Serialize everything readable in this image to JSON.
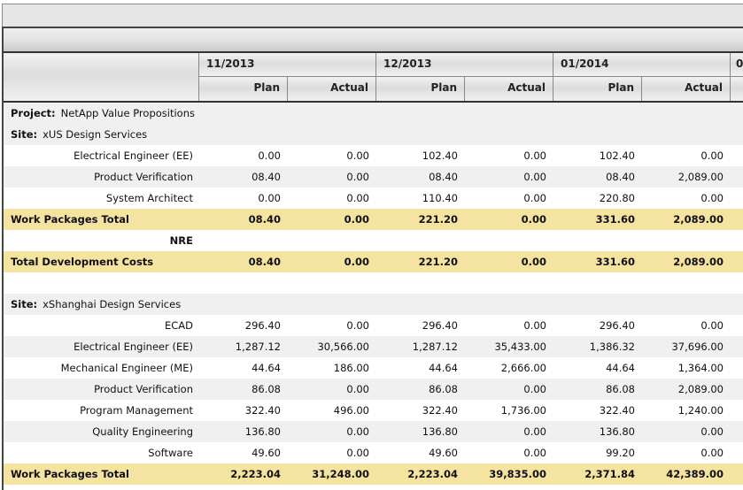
{
  "header": {
    "months": [
      "11/2013",
      "12/2013",
      "01/2014",
      "0"
    ],
    "sub_labels": {
      "plan": "Plan",
      "actual": "Actual"
    }
  },
  "rows": [
    {
      "type": "group",
      "style": "grey",
      "prefix": "Project:",
      "label": "NetApp Value Propositions"
    },
    {
      "type": "group",
      "style": "grey",
      "prefix": "Site:",
      "label": "xUS Design Services"
    },
    {
      "type": "data",
      "style": "white",
      "label": "Electrical Engineer (EE)",
      "values": [
        "0.00",
        "0.00",
        "102.40",
        "0.00",
        "102.40",
        "0.00"
      ]
    },
    {
      "type": "data",
      "style": "grey",
      "label": "Product Verification",
      "values": [
        "08.40",
        "0.00",
        "08.40",
        "0.00",
        "08.40",
        "2,089.00"
      ]
    },
    {
      "type": "data",
      "style": "white",
      "label": "System Architect",
      "values": [
        "0.00",
        "0.00",
        "110.40",
        "0.00",
        "220.80",
        "0.00"
      ]
    },
    {
      "type": "total",
      "style": "yellow",
      "label": "Work Packages Total",
      "values": [
        "08.40",
        "0.00",
        "221.20",
        "0.00",
        "331.60",
        "2,089.00"
      ]
    },
    {
      "type": "heading",
      "style": "white",
      "label": "NRE",
      "values": []
    },
    {
      "type": "total",
      "style": "yellow",
      "label": "Total Development Costs",
      "values": [
        "08.40",
        "0.00",
        "221.20",
        "0.00",
        "331.60",
        "2,089.00"
      ]
    },
    {
      "type": "blank",
      "style": "white",
      "label": "",
      "values": []
    },
    {
      "type": "group",
      "style": "grey",
      "prefix": "Site:",
      "label": "xShanghai Design Services"
    },
    {
      "type": "data",
      "style": "white",
      "label": "ECAD",
      "values": [
        "296.40",
        "0.00",
        "296.40",
        "0.00",
        "296.40",
        "0.00"
      ]
    },
    {
      "type": "data",
      "style": "grey",
      "label": "Electrical Engineer (EE)",
      "values": [
        "1,287.12",
        "30,566.00",
        "1,287.12",
        "35,433.00",
        "1,386.32",
        "37,696.00"
      ]
    },
    {
      "type": "data",
      "style": "white",
      "label": "Mechanical Engineer (ME)",
      "values": [
        "44.64",
        "186.00",
        "44.64",
        "2,666.00",
        "44.64",
        "1,364.00"
      ]
    },
    {
      "type": "data",
      "style": "grey",
      "label": "Product Verification",
      "values": [
        "86.08",
        "0.00",
        "86.08",
        "0.00",
        "86.08",
        "2,089.00"
      ]
    },
    {
      "type": "data",
      "style": "white",
      "label": "Program Management",
      "values": [
        "322.40",
        "496.00",
        "322.40",
        "1,736.00",
        "322.40",
        "1,240.00"
      ]
    },
    {
      "type": "data",
      "style": "grey",
      "label": "Quality Engineering",
      "values": [
        "136.80",
        "0.00",
        "136.80",
        "0.00",
        "136.80",
        "0.00"
      ]
    },
    {
      "type": "data",
      "style": "white",
      "label": "Software",
      "values": [
        "49.60",
        "0.00",
        "49.60",
        "0.00",
        "99.20",
        "0.00"
      ]
    },
    {
      "type": "total",
      "style": "yellow",
      "label": "Work Packages Total",
      "values": [
        "2,223.04",
        "31,248.00",
        "2,223.04",
        "39,835.00",
        "2,371.84",
        "42,389.00"
      ]
    }
  ]
}
